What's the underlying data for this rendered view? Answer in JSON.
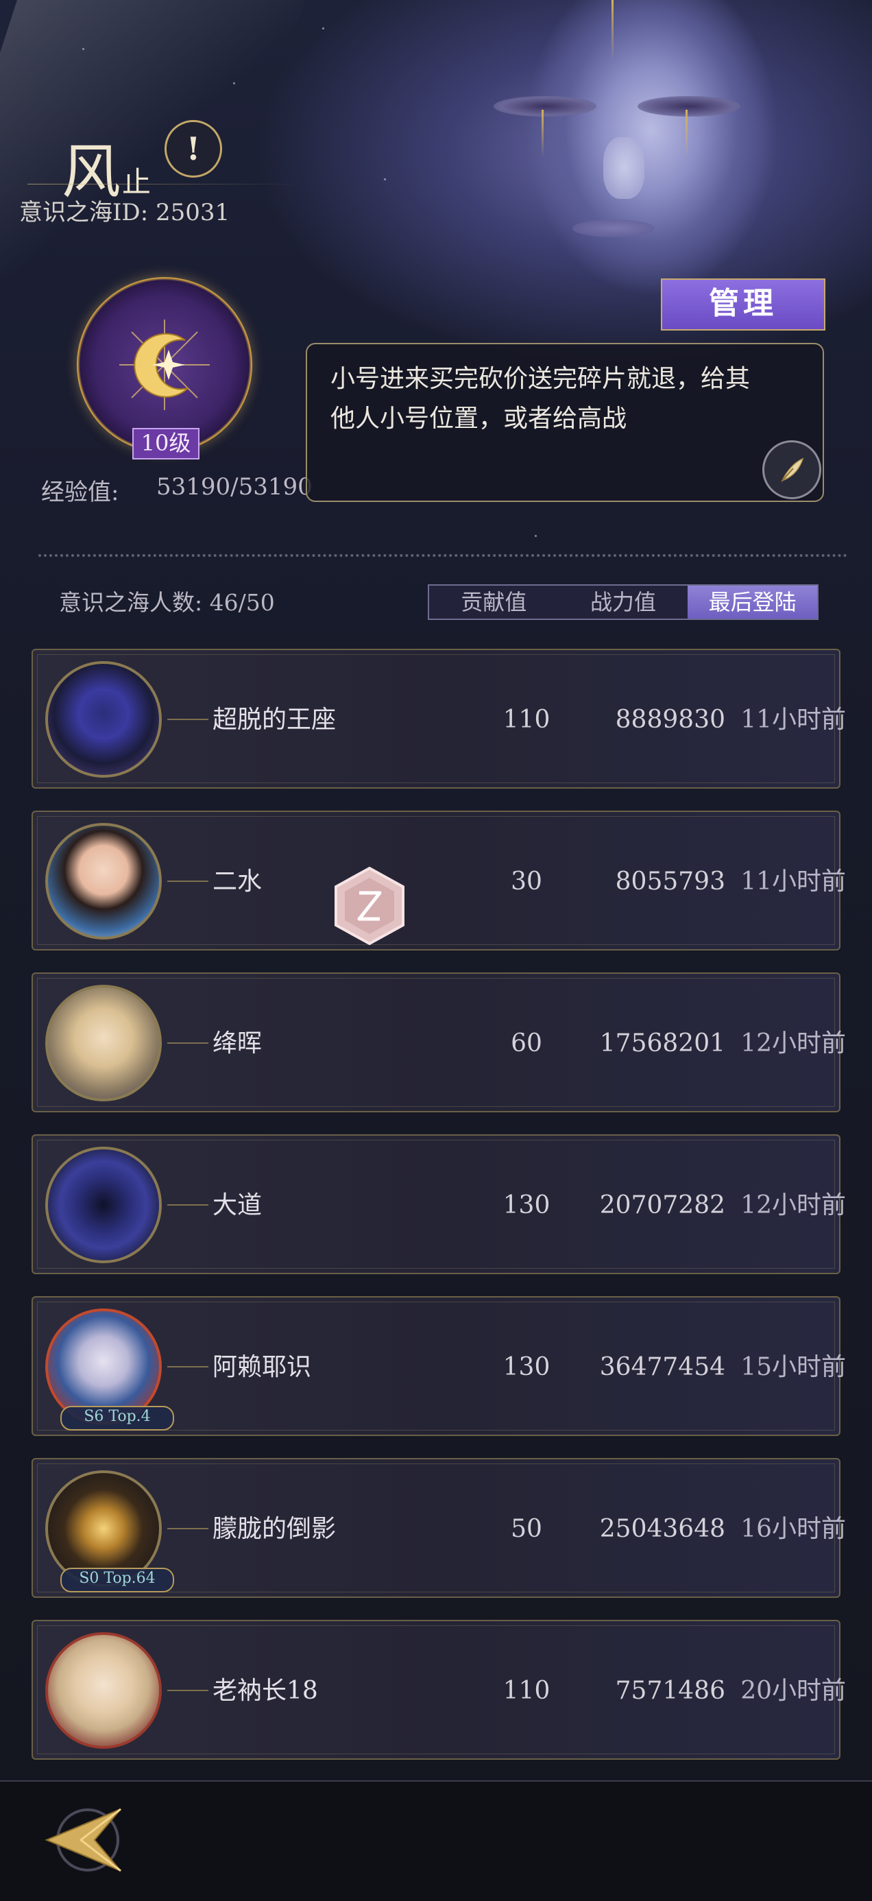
{
  "header": {
    "guild_name": "风",
    "guild_name_suffix": "止",
    "guild_id_label": "意识之海ID: 25031",
    "alert_icon": "exclamation-icon"
  },
  "profile": {
    "level": "10级",
    "exp_label": "经验值:",
    "exp_value": "53190/53190",
    "emblem_icon": "crescent-moon-star-emblem"
  },
  "manage": {
    "label": "管理"
  },
  "notice": {
    "text_line1": "小号进来买完砍价送完碎片就退，给其",
    "text_line2": "他人小号位置，或者给高战",
    "edit_icon": "quill-icon"
  },
  "members_header": {
    "count_label": "意识之海人数: 46/50",
    "tabs": [
      {
        "label": "贡献值",
        "active": false
      },
      {
        "label": "战力值",
        "active": false
      },
      {
        "label": "最后登陆",
        "active": true
      }
    ]
  },
  "members": [
    {
      "name": "超脱的王座",
      "contribution": "110",
      "power": "8889830",
      "last_login": "11小时前",
      "badge": ""
    },
    {
      "name": "二水",
      "contribution": "30",
      "power": "8055793",
      "last_login": "11小时前",
      "badge": ""
    },
    {
      "name": "绛晖",
      "contribution": "60",
      "power": "17568201",
      "last_login": "12小时前",
      "badge": ""
    },
    {
      "name": "大道",
      "contribution": "130",
      "power": "20707282",
      "last_login": "12小时前",
      "badge": ""
    },
    {
      "name": "阿赖耶识",
      "contribution": "130",
      "power": "36477454",
      "last_login": "15小时前",
      "badge": "S6 Top.4"
    },
    {
      "name": "朦胧的倒影",
      "contribution": "50",
      "power": "25043648",
      "last_login": "16小时前",
      "badge": "S0 Top.64"
    },
    {
      "name": "老衲长18",
      "contribution": "110",
      "power": "7571486",
      "last_login": "20小时前",
      "badge": ""
    }
  ],
  "colors": {
    "gold": "#c8a96d",
    "accent_purple": "#6e5fc0",
    "background": "#15161f"
  },
  "bottom": {
    "back_icon": "back-arrow-icon"
  }
}
